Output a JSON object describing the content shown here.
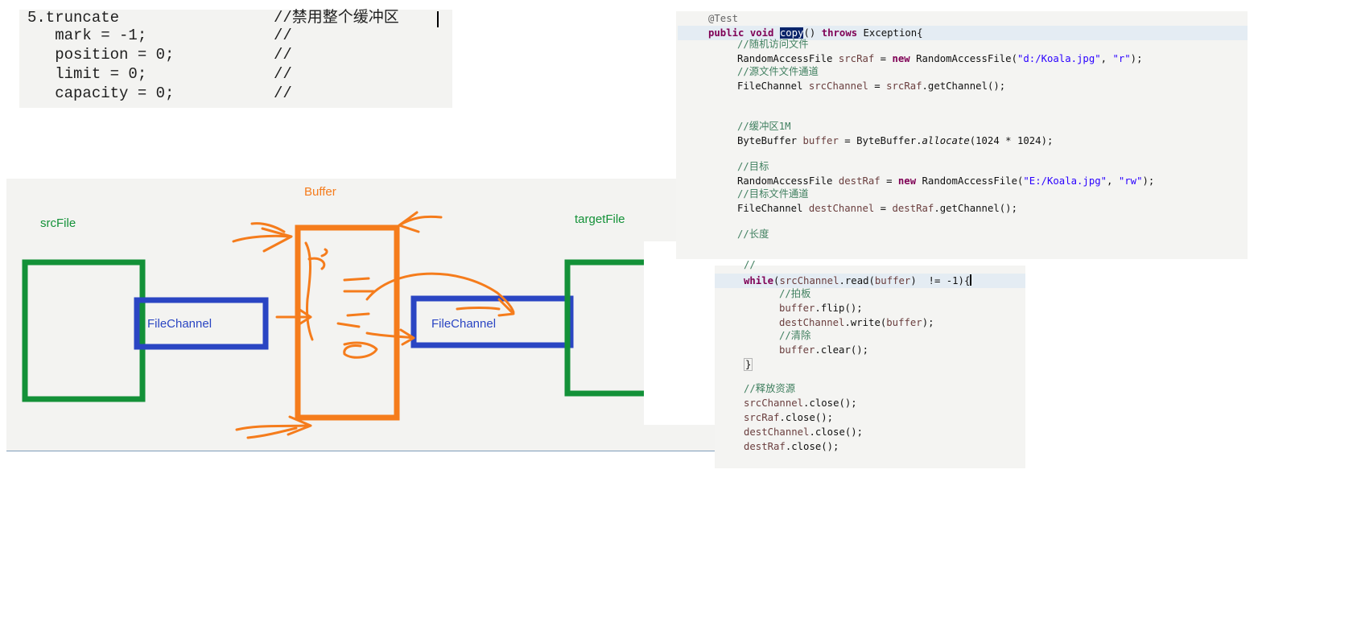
{
  "truncate": {
    "lines": [
      {
        "code": "5.truncate",
        "comment": "//禁用整个缓冲区"
      },
      {
        "code": "   mark = -1;",
        "comment": "//"
      },
      {
        "code": "   position = 0;",
        "comment": "//"
      },
      {
        "code": "   limit = 0;",
        "comment": "//"
      },
      {
        "code": "   capacity = 0;",
        "comment": "//"
      }
    ]
  },
  "diagram": {
    "src_label": "srcFile",
    "buffer_label": "Buffer",
    "target_label": "targetFile",
    "channel_left_label": "FileChannel",
    "channel_right_label": "FileChannel",
    "colors": {
      "file": "#139138",
      "channel": "#2a45c3",
      "buffer": "#f57c1c",
      "text_green": "#139138",
      "text_blue": "#2a45c3",
      "text_orange": "#f57c1c"
    }
  },
  "code": {
    "annotation": "@Test",
    "method_kw1": "public",
    "method_kw2": "void",
    "method_name": "copy",
    "method_rest": "() ",
    "method_kw3": "throws",
    "method_tail": " Exception{",
    "c_random": "//随机访问文件",
    "raf_src_pre": "RandomAccessFile ",
    "raf_src_var": "srcRaf",
    "raf_src_eq": " = ",
    "kw_new": "new",
    "raf_src_call": " RandomAccessFile(",
    "raf_src_str1": "\"d:/Koala.jpg\"",
    "comma": ", ",
    "raf_src_str2": "\"r\"",
    "close_stmt": ");",
    "c_src_channel": "//源文件文件通道",
    "fc_src_pre": "FileChannel ",
    "fc_src_var": "srcChannel",
    "fc_src_eq": " = ",
    "fc_src_obj": "srcRaf",
    "fc_src_call": ".getChannel();",
    "c_buffer": "//缓冲区1M",
    "bb_pre": "ByteBuffer ",
    "bb_var": "buffer",
    "bb_eq": " = ByteBuffer.",
    "bb_method": "allocate",
    "bb_args": "(1024 * 1024);",
    "c_target": "//目标",
    "raf_dst_pre": "RandomAccessFile ",
    "raf_dst_var": "destRaf",
    "raf_dst_str1": "\"E:/Koala.jpg\"",
    "raf_dst_str2": "\"rw\"",
    "c_target_channel": "//目标文件通道",
    "fc_dst_var": "destChannel",
    "fc_dst_obj": "destRaf",
    "c_length": "//长度",
    "c_slashes": "//",
    "kw_while": "while",
    "while_open": "(",
    "while_var": "srcChannel",
    "while_read": ".read(",
    "while_buf": "buffer",
    "while_close": ")  != -1){",
    "c_flip": "//拍板",
    "flip_obj": "buffer",
    "flip_call": ".flip();",
    "write_obj": "destChannel",
    "write_call": ".write(",
    "write_arg": "buffer",
    "write_end": ");",
    "c_clear": "//清除",
    "clear_obj": "buffer",
    "clear_call": ".clear();",
    "brace": "}",
    "c_release": "//释放资源",
    "close1_obj": "srcChannel",
    "close_call": ".close();",
    "close2_obj": "srcRaf",
    "close3_obj": "destChannel",
    "close4_obj": "destRaf"
  }
}
